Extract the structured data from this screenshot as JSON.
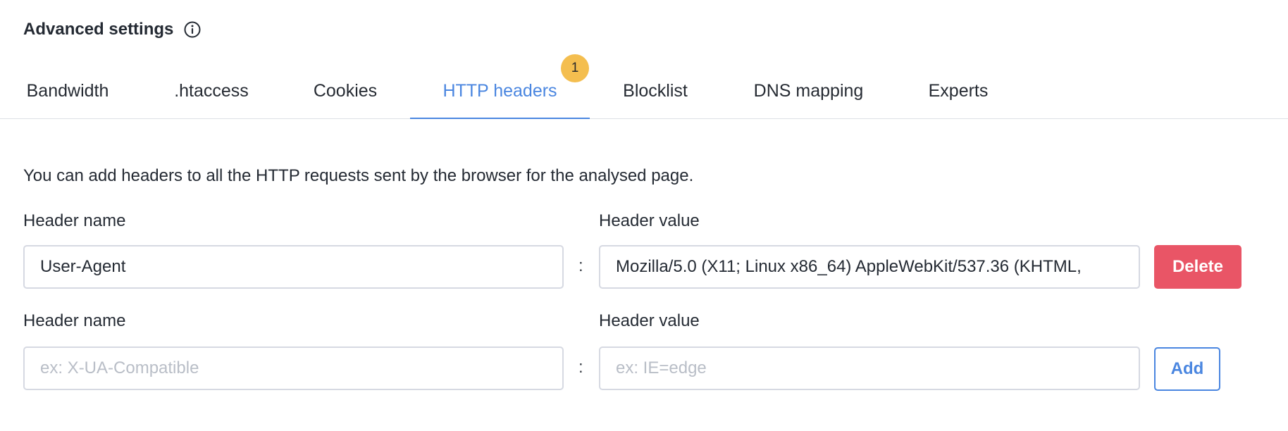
{
  "section": {
    "title": "Advanced settings",
    "info_icon": "info-circle-icon"
  },
  "tabs": [
    {
      "label": "Bandwidth",
      "active": false
    },
    {
      "label": ".htaccess",
      "active": false
    },
    {
      "label": "Cookies",
      "active": false
    },
    {
      "label": "HTTP headers",
      "active": true,
      "badge": "1"
    },
    {
      "label": "Blocklist",
      "active": false
    },
    {
      "label": "DNS mapping",
      "active": false
    },
    {
      "label": "Experts",
      "active": false
    }
  ],
  "description": "You can add headers to all the HTTP requests sent by the browser for the analysed page.",
  "rows": [
    {
      "name_label": "Header name",
      "value_label": "Header value",
      "name_value": "User-Agent",
      "value_value": "Mozilla/5.0 (X11; Linux x86_64) AppleWebKit/537.36 (KHTML,",
      "separator": ":",
      "action_label": "Delete"
    },
    {
      "name_label": "Header name",
      "value_label": "Header value",
      "name_placeholder": "ex: X-UA-Compatible",
      "value_placeholder": "ex: IE=edge",
      "separator": ":",
      "action_label": "Add"
    }
  ],
  "colors": {
    "accent": "#4a86e0",
    "danger": "#e95566",
    "badge": "#f4be4f"
  }
}
